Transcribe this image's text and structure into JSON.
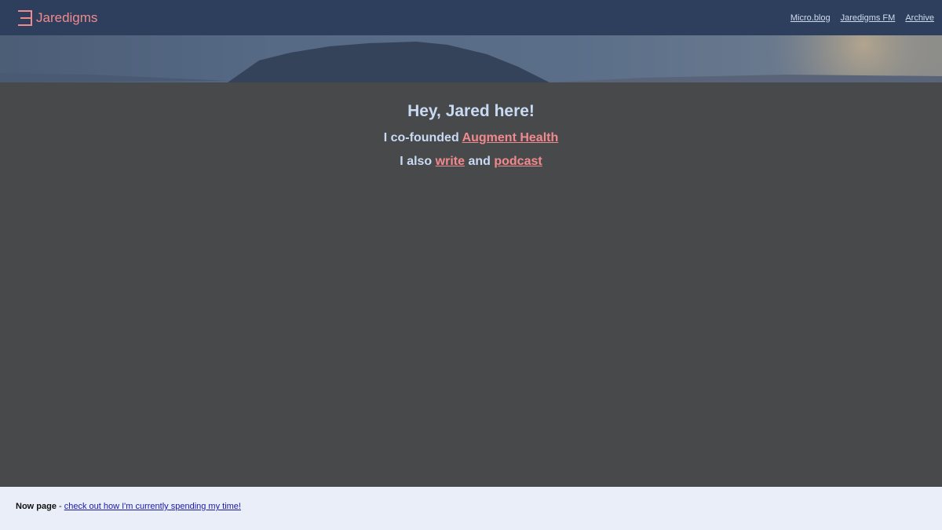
{
  "header": {
    "brand_name": "Jaredigms",
    "nav": [
      {
        "label": "Micro.blog"
      },
      {
        "label": "Jaredigms FM"
      },
      {
        "label": "Archive"
      }
    ]
  },
  "intro": {
    "greeting": "Hey, Jared here!",
    "cofounded_prefix": "I co-founded ",
    "company_link": "Augment Health",
    "also_prefix": "I also ",
    "write_link": "write",
    "and_text": " and ",
    "podcast_link": "podcast"
  },
  "footer": {
    "now_label": "Now page",
    "separator": " - ",
    "now_link": "check out how I'm currently spending my time!"
  },
  "colors": {
    "navbar": "#2d3f5c",
    "accent": "#f08a8e",
    "text": "#c9daf4",
    "background": "#48494b",
    "footer": "#eaeef8"
  }
}
